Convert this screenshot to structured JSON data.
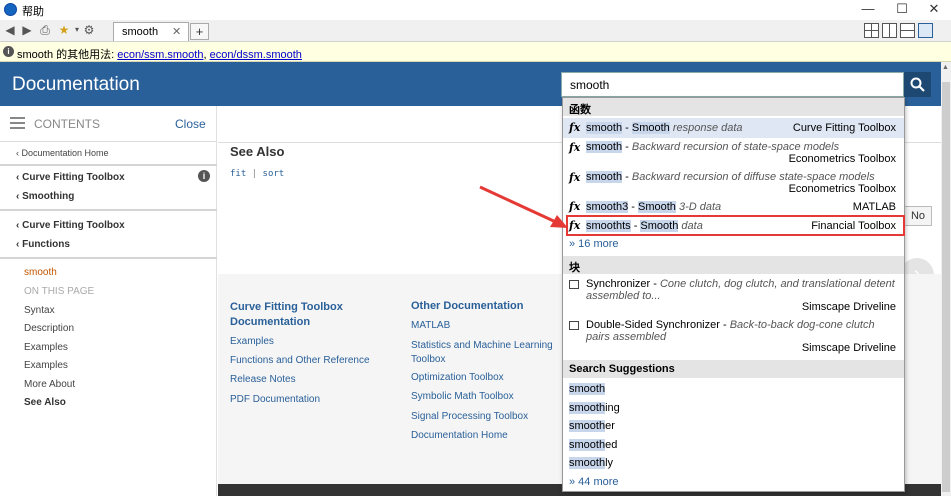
{
  "window": {
    "title": "帮助",
    "controls": [
      "—",
      "☐",
      "✕"
    ]
  },
  "toolbar": {
    "tab_label": "smooth",
    "tab_close": "✕",
    "new_tab": "+"
  },
  "infobar": {
    "prefix": "smooth 的其他用法: ",
    "link1": "econ/ssm.smooth",
    "sep": ", ",
    "link2": "econ/dssm.smooth"
  },
  "header": {
    "title": "Documentation",
    "search_value": "smooth"
  },
  "sidebar": {
    "contents_label": "CONTENTS",
    "close_label": "Close",
    "doc_home": "‹ Documentation Home",
    "crumb1": "‹ Curve Fitting Toolbox",
    "crumb2": "‹ Smoothing",
    "crumb3": "‹ Curve Fitting Toolbox",
    "crumb4": "‹ Functions",
    "current": "smooth",
    "on_this_page": "ON THIS PAGE",
    "page_items": [
      "Syntax",
      "Description",
      "Examples",
      "Examples",
      "More About",
      "See Also"
    ]
  },
  "main": {
    "see_also_heading": "See Also",
    "see_also_link1": "fit",
    "see_also_sep": " | ",
    "see_also_link2": "sort",
    "partial_button": "No",
    "footer": {
      "col1_heading": "Curve Fitting Toolbox Documentation",
      "col1_links": [
        "Examples",
        "Functions and Other Reference",
        "Release Notes",
        "PDF Documentation"
      ],
      "col2_heading": "Other Documentation",
      "col2_links": [
        "MATLAB",
        "Statistics and Machine Learning Toolbox",
        "Optimization Toolbox",
        "Symbolic Math Toolbox",
        "Signal Processing Toolbox",
        "Documentation Home"
      ]
    }
  },
  "dropdown": {
    "section_functions": "函数",
    "functions": [
      {
        "icon": "fx",
        "name": "smooth",
        "sep": " - ",
        "lead": "Smooth",
        "desc": " response data",
        "product": "Curve Fitting Toolbox"
      },
      {
        "icon": "fx",
        "name": "smooth",
        "sep": " - ",
        "lead": "",
        "desc": "Backward recursion of state-space models",
        "product": "Econometrics Toolbox"
      },
      {
        "icon": "fx",
        "name": "smooth",
        "sep": " - ",
        "lead": "",
        "desc": "Backward recursion of diffuse state-space models",
        "product": "Econometrics Toolbox"
      },
      {
        "icon": "fx",
        "name": "smooth3",
        "sep": " - ",
        "lead": "Smooth",
        "desc": " 3-D data",
        "product": "MATLAB"
      },
      {
        "icon": "fx",
        "name": "smoothts",
        "sep": " - ",
        "lead": "Smooth",
        "desc": " data",
        "product": "Financial Toolbox"
      }
    ],
    "functions_more": "» 16 more",
    "section_blocks": "块",
    "blocks": [
      {
        "name": "Synchronizer",
        "desc": "Cone clutch, dog clutch, and translational detent assembled to...",
        "product": "Simscape Driveline"
      },
      {
        "name": "Double-Sided Synchronizer",
        "desc": "Back-to-back dog-cone clutch pairs assembled",
        "product": "Simscape Driveline"
      }
    ],
    "section_suggestions": "Search Suggestions",
    "suggestions": [
      {
        "hl": "smooth",
        "rest": ""
      },
      {
        "hl": "smooth",
        "rest": "ing"
      },
      {
        "hl": "smooth",
        "rest": "er"
      },
      {
        "hl": "smooth",
        "rest": "ed"
      },
      {
        "hl": "smooth",
        "rest": "ly"
      }
    ],
    "suggestions_more": "» 44 more"
  },
  "colors": {
    "header_bg": "#2a6099",
    "link": "#2a6099",
    "current_page": "#c45500",
    "annotation": "#e53935"
  }
}
